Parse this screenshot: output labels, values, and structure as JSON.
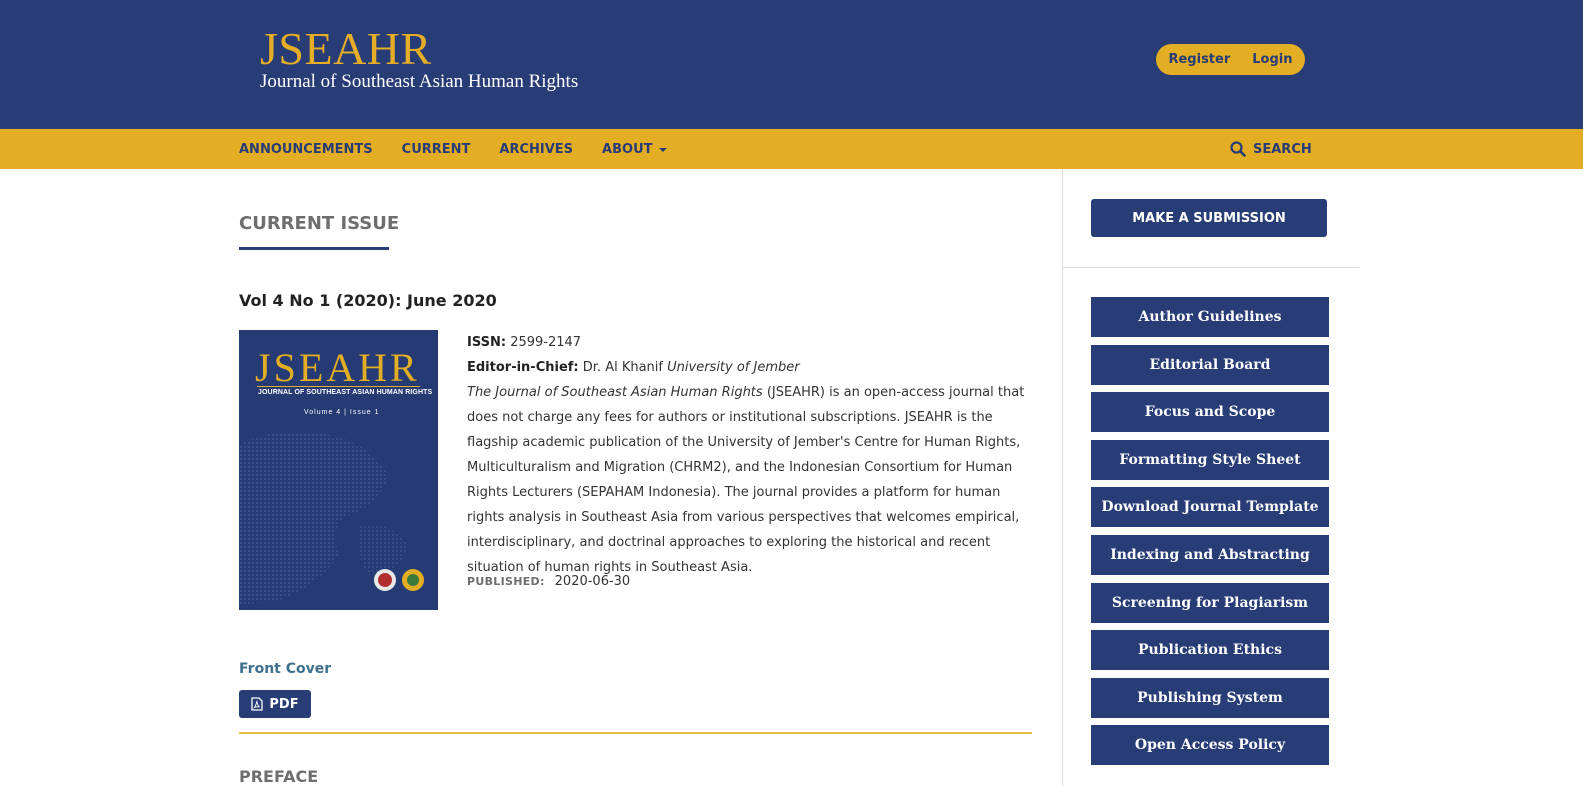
{
  "header": {
    "logo_title": "JSEAHR",
    "logo_subtitle": "Journal of Southeast Asian Human Rights",
    "register_label": "Register",
    "login_label": "Login"
  },
  "nav": {
    "items": [
      {
        "label": "ANNOUNCEMENTS"
      },
      {
        "label": "CURRENT"
      },
      {
        "label": "ARCHIVES"
      },
      {
        "label": "ABOUT"
      }
    ],
    "search_label": "SEARCH"
  },
  "main": {
    "section_heading": "CURRENT ISSUE",
    "issue_title": "Vol 4 No 1 (2020): June 2020",
    "cover": {
      "title": "JSEAHR",
      "subtitle": "JOURNAL OF SOUTHEAST ASIAN HUMAN RIGHTS",
      "volume": "Volume 4 | Issue 1"
    },
    "issn_label": "ISSN:",
    "issn_value": "2599-2147",
    "editor_label": "Editor-in-Chief:",
    "editor_name": "Dr. Al Khanif",
    "editor_affiliation": "University of Jember",
    "description_italic": "The Journal of Southeast Asian Human Rights",
    "description_rest": " (JSEAHR) is an open-access journal that does not charge any fees for authors or institutional subscriptions. JSEAHR is the flagship academic publication of the University of Jember's Centre for Human Rights, Multiculturalism and Migration (CHRM2), and the Indonesian Consortium for Human Rights Lecturers (SEPAHAM Indonesia). The journal provides a platform for human rights analysis in Southeast Asia from various perspectives that welcomes empirical, interdisciplinary, and doctrinal approaches to exploring the historical and recent situation of human rights in Southeast Asia.",
    "published_label": "PUBLISHED:",
    "published_date": "2020-06-30",
    "front_cover_label": "Front Cover",
    "pdf_label": "PDF",
    "next_section": "PREFACE"
  },
  "sidebar": {
    "submit_label": "MAKE A SUBMISSION",
    "links": [
      {
        "label": "Author Guidelines"
      },
      {
        "label": "Editorial Board"
      },
      {
        "label": "Focus and Scope"
      },
      {
        "label": "Formatting Style Sheet"
      },
      {
        "label": "Download Journal Template"
      },
      {
        "label": "Indexing and Abstracting"
      },
      {
        "label": "Screening for Plagiarism"
      },
      {
        "label": "Publication Ethics"
      },
      {
        "label": "Publishing System"
      },
      {
        "label": "Open Access Policy"
      }
    ]
  },
  "colors": {
    "primary": "#283c76",
    "accent": "#e3ae24"
  }
}
